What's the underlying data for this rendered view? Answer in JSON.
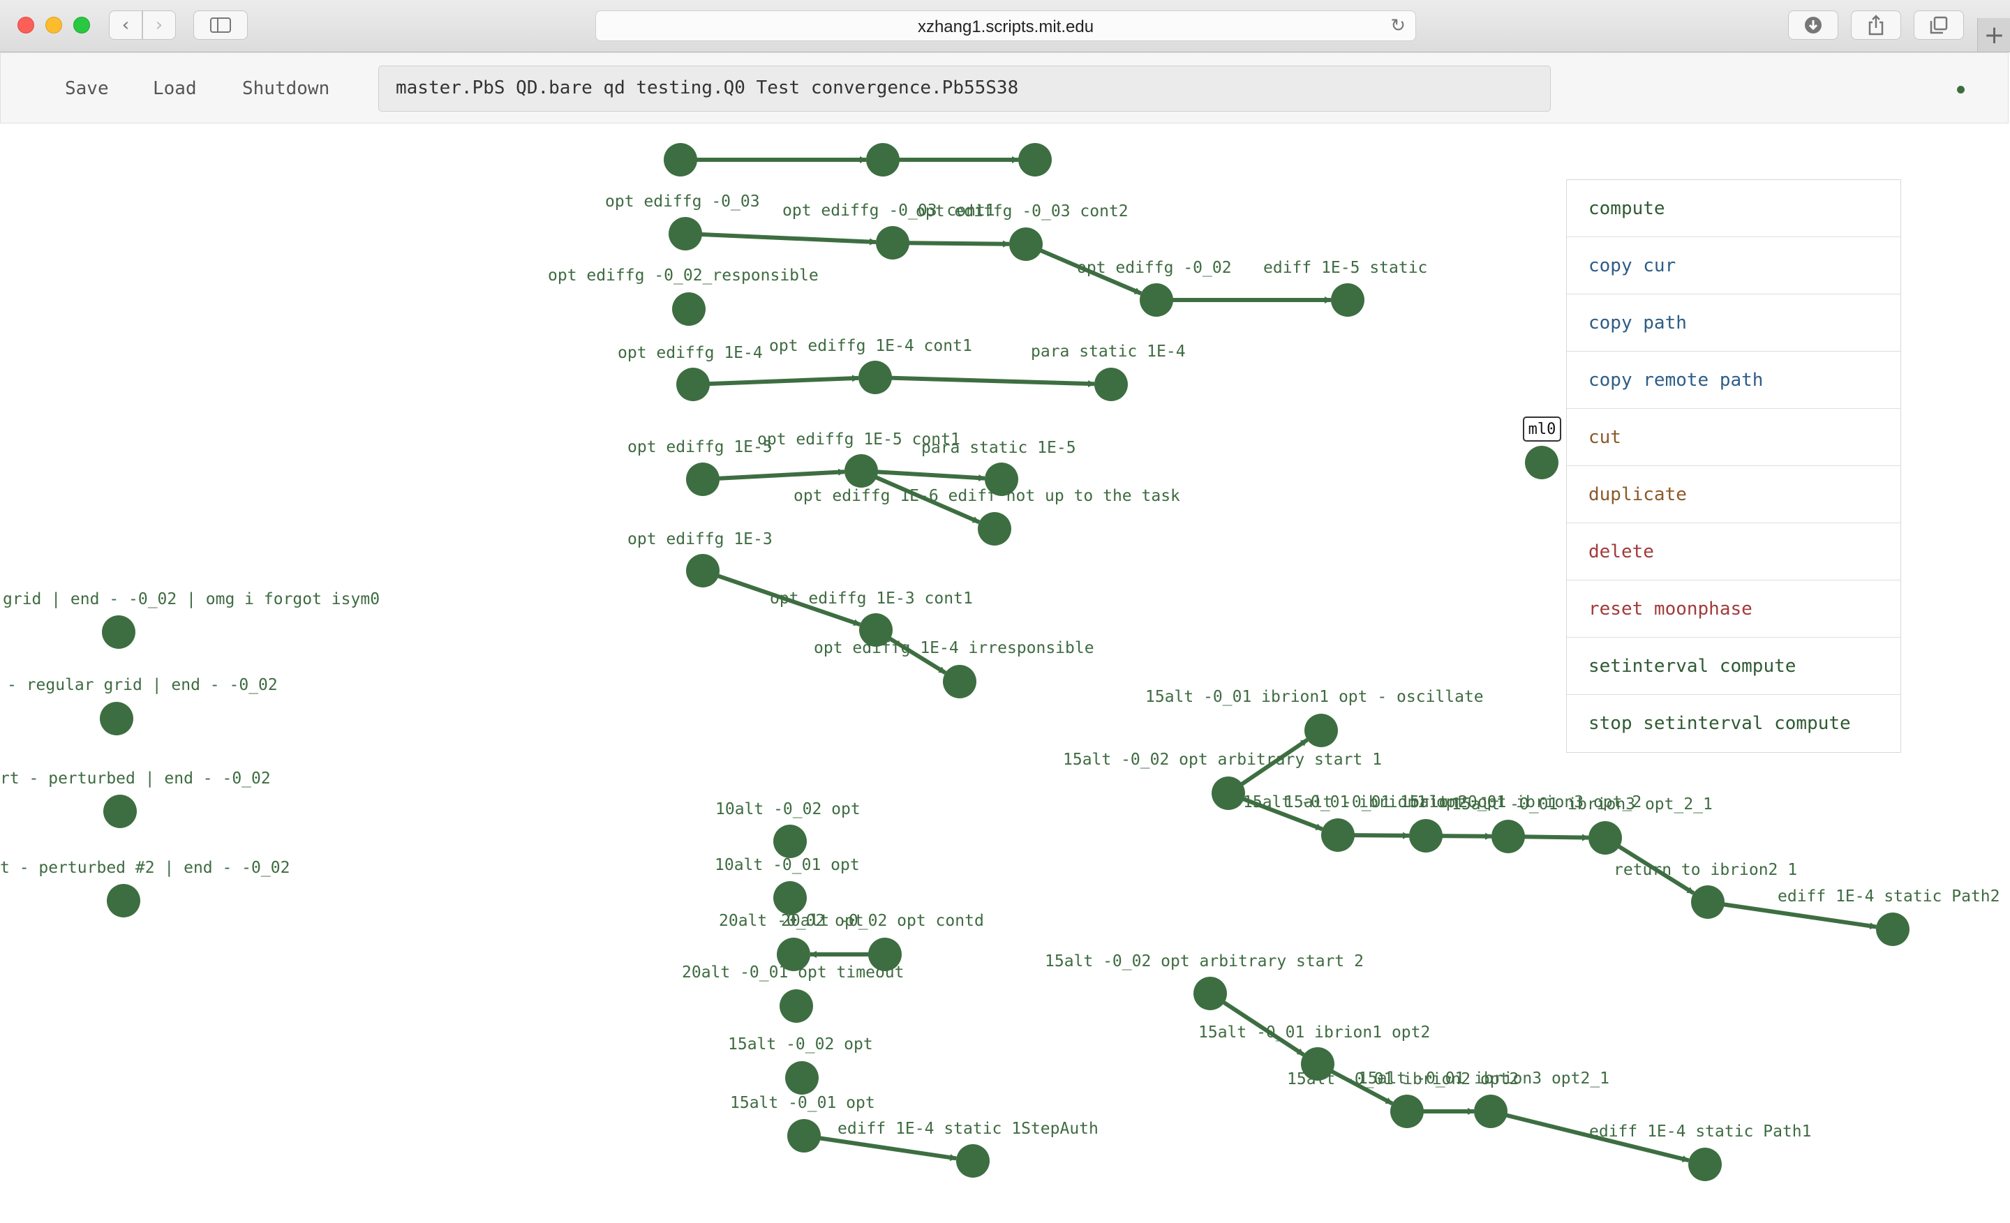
{
  "browser": {
    "url": "xzhang1.scripts.mit.edu",
    "icons": [
      "back-arrow-icon",
      "forward-arrow-icon",
      "sidebar-icon",
      "reload-icon",
      "download-icon",
      "share-icon",
      "tabs-icon",
      "plus-icon"
    ]
  },
  "toolbar": {
    "save_label": "Save",
    "load_label": "Load",
    "shutdown_label": "Shutdown",
    "path_value": "master.PbS QD.bare qd testing.Q0 Test convergence.Pb55S38"
  },
  "colors": {
    "node": "#3d6e41",
    "edge": "#3d6e41",
    "label": "#3e6b41",
    "menu_blue": "#2e5d86",
    "menu_brown": "#8a5a2b",
    "menu_red": "#a33a3a",
    "menu_green": "#2f5a33"
  },
  "labels": {
    "l1": "opt ediffg -0_03",
    "l2": "opt ediffg -0_03 cont1",
    "l3": "opt ediffg -0_03 cont2",
    "l4": "opt ediffg -0_02_responsible",
    "l5": "opt ediffg -0_02",
    "l6": "ediff 1E-5 static",
    "l7": "opt ediffg 1E-4",
    "l8": "opt ediffg 1E-4 cont1",
    "l9": "para static 1E-4",
    "l10": "opt ediffg 1E-5",
    "l11": "opt ediffg 1E-5 cont1",
    "l12": "para static 1E-5",
    "l13": "opt ediffg 1E-6 ediff not up to the task",
    "l14": "opt ediffg 1E-3",
    "l15": "opt ediffg 1E-3 cont1",
    "l16": "opt ediffg 1E-4 irresponsible",
    "l17": "grid | end - -0_02 | omg i forgot isym0",
    "l18": "- regular grid | end - -0_02",
    "l19": "rt - perturbed | end - -0_02",
    "l20": "t - perturbed #2 | end - -0_02",
    "l21": "10alt -0_02 opt",
    "l22": "10alt -0_01 opt",
    "l23": "20alt -0_02 opt",
    "l24": "20alt -0_02 opt contd",
    "l25": "20alt -0_01 opt timeout",
    "l26": "15alt -0_02 opt",
    "l27": "15alt -0_01 opt",
    "l28": "ediff 1E-4 static 1StepAuth",
    "l29": "15alt -0_01 ibrion1 opt - oscillate",
    "l30": "15alt -0_02 opt arbitrary start 1",
    "l31": "15alt -0_01 ibrion1 opt",
    "l32": "15alt -0_01 ibrion2 opt",
    "l33": "15alt -0_01 ibrion3 opt_2",
    "l34": "15alt -0_01 ibrion3 opt_2_1",
    "l35": "return to ibrion2 1",
    "l36": "ediff 1E-4 static Path2",
    "l37": "15alt -0_02 opt arbitrary start 2",
    "l38": "15alt -0_01 ibrion1 opt2",
    "l39": "15alt -0_01 ibrion2 opt2",
    "l40": "15alt -0_01 ibrion3 opt2_1",
    "l41": "ediff 1E-4 static Path1"
  },
  "tag": "ml0",
  "context_menu": [
    {
      "label": "compute",
      "color": "#2f5a33"
    },
    {
      "label": "copy cur",
      "color": "#2e5d86"
    },
    {
      "label": "copy path",
      "color": "#2e5d86"
    },
    {
      "label": "copy remote path",
      "color": "#2e5d86"
    },
    {
      "label": "cut",
      "color": "#8a5a2b"
    },
    {
      "label": "duplicate",
      "color": "#8a5a2b"
    },
    {
      "label": "delete",
      "color": "#a33a3a"
    },
    {
      "label": "reset moonphase",
      "color": "#a33a3a"
    },
    {
      "label": "setinterval compute",
      "color": "#2f5a33"
    },
    {
      "label": "stop setinterval compute",
      "color": "#2f5a33"
    }
  ]
}
